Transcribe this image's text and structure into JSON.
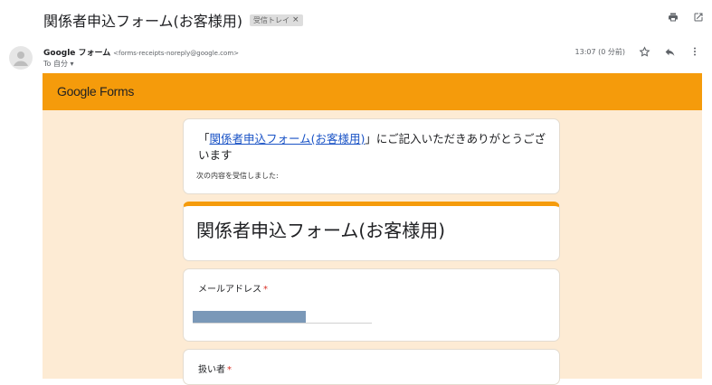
{
  "email": {
    "subject": "関係者申込フォーム(お客様用)",
    "label": "受信トレイ",
    "label_close": "×",
    "sender_name": "Google フォーム",
    "sender_email": "<forms-receipts-noreply@google.com>",
    "to_line": "To 自分 ▾",
    "time": "13:07 (0 分前)"
  },
  "forms_header": {
    "logo_google": "Google",
    "logo_forms": " Forms",
    "brand_color": "#f59b0b"
  },
  "intro_card": {
    "open_quote": "「",
    "form_link": "関係者申込フォーム(お客様用)",
    "rest": "」にご記入いただきありがとうございます",
    "received": "次の内容を受信しました:"
  },
  "form": {
    "title": "関係者申込フォーム(お客様用)",
    "questions": [
      {
        "label": "メールアドレス",
        "required": "*"
      },
      {
        "label": "扱い者",
        "required": "*"
      }
    ]
  },
  "icons": [
    "print-icon",
    "open-in-new-icon",
    "star-icon",
    "reply-icon",
    "more-vert-icon",
    "avatar-icon"
  ]
}
